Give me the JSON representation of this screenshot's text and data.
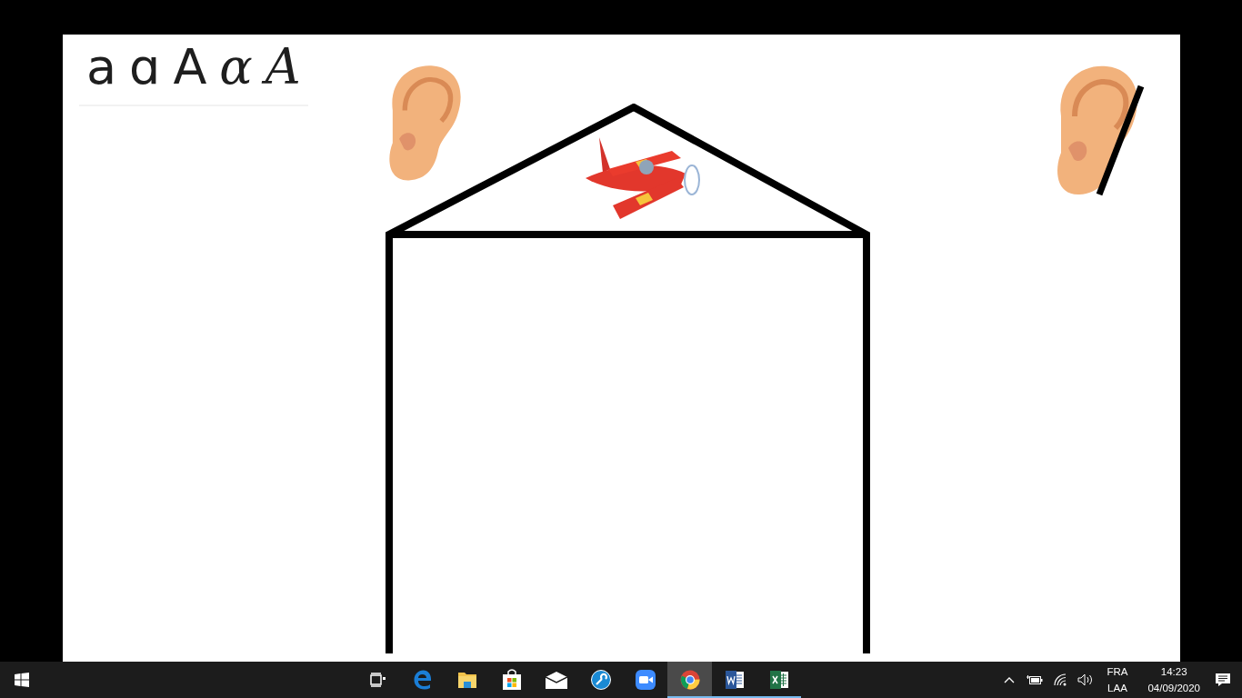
{
  "slide": {
    "letters": [
      {
        "text": "a",
        "kind": "print"
      },
      {
        "text": "ɑ",
        "kind": "print"
      },
      {
        "text": "A",
        "kind": "print"
      },
      {
        "text": "α",
        "kind": "cursive"
      },
      {
        "text": "A",
        "kind": "cursive"
      }
    ],
    "ears": [
      {
        "crossed": false
      },
      {
        "crossed": true
      }
    ]
  },
  "taskbar": {
    "apps": [
      {
        "kind": "taskview",
        "running": false,
        "selected": false
      },
      {
        "kind": "edge",
        "running": false,
        "selected": false
      },
      {
        "kind": "folder",
        "running": false,
        "selected": false
      },
      {
        "kind": "store",
        "running": false,
        "selected": false
      },
      {
        "kind": "mail",
        "running": false,
        "selected": false
      },
      {
        "kind": "tool",
        "running": false,
        "selected": false
      },
      {
        "kind": "video",
        "running": false,
        "selected": false
      },
      {
        "kind": "chrome",
        "running": true,
        "selected": true
      },
      {
        "kind": "word",
        "running": true,
        "selected": false
      },
      {
        "kind": "excel",
        "running": true,
        "selected": false
      }
    ],
    "language": [
      "FRA",
      "LAA"
    ],
    "time": "14:23",
    "date": "04/09/2020"
  }
}
